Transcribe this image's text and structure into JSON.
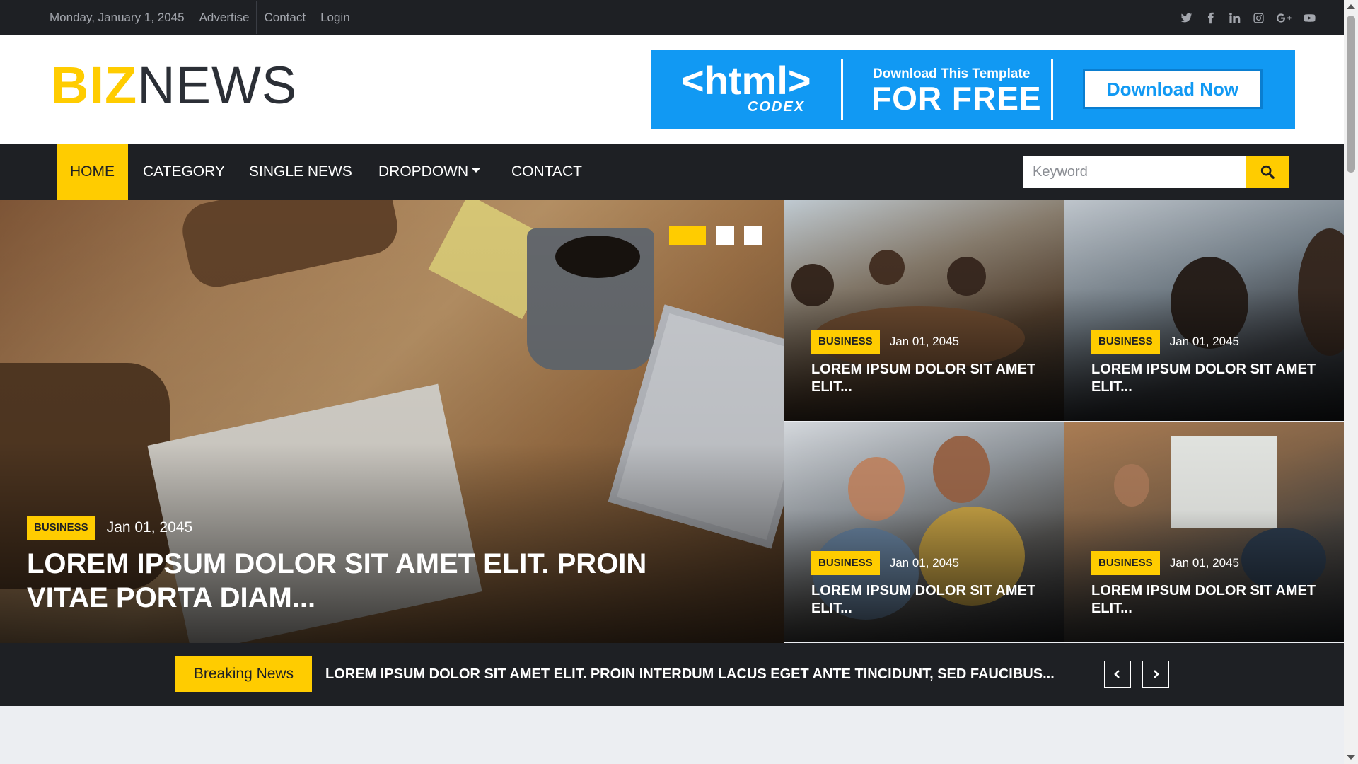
{
  "topbar": {
    "date": "Monday, January 1, 2045",
    "links": [
      "Advertise",
      "Contact",
      "Login"
    ],
    "socials": [
      "twitter-icon",
      "facebook-icon",
      "linkedin-icon",
      "instagram-icon",
      "google-plus-icon",
      "youtube-icon"
    ]
  },
  "logo": {
    "part1": "BIZ",
    "part2": "NEWS"
  },
  "ad": {
    "brand": "<html>",
    "brand_sub": "CODEX",
    "line1": "Download This Template",
    "line2": "FOR FREE",
    "button": "Download Now"
  },
  "nav": {
    "items": [
      "HOME",
      "CATEGORY",
      "SINGLE NEWS",
      "DROPDOWN",
      "CONTACT"
    ],
    "active": "HOME"
  },
  "search": {
    "placeholder": "Keyword",
    "value": ""
  },
  "carousel": {
    "slides": 3,
    "active_index": 0
  },
  "hero": {
    "tag": "BUSINESS",
    "date": "Jan 01, 2045",
    "title": "LOREM IPSUM DOLOR SIT AMET ELIT. PROIN VITAE PORTA DIAM..."
  },
  "cards": [
    {
      "tag": "BUSINESS",
      "date": "Jan 01, 2045",
      "title": "LOREM IPSUM DOLOR SIT AMET ELIT..."
    },
    {
      "tag": "BUSINESS",
      "date": "Jan 01, 2045",
      "title": "LOREM IPSUM DOLOR SIT AMET ELIT..."
    },
    {
      "tag": "BUSINESS",
      "date": "Jan 01, 2045",
      "title": "LOREM IPSUM DOLOR SIT AMET ELIT..."
    },
    {
      "tag": "BUSINESS",
      "date": "Jan 01, 2045",
      "title": "LOREM IPSUM DOLOR SIT AMET ELIT..."
    }
  ],
  "breaking": {
    "label": "Breaking News",
    "text": "LOREM IPSUM DOLOR SIT AMET ELIT. PROIN INTERDUM LACUS EGET ANTE TINCIDUNT, SED FAUCIBUS..."
  },
  "colors": {
    "accent": "#ffcc00",
    "dark": "#1e2024",
    "ad_blue": "#1199f3",
    "background": "#eceef2"
  }
}
